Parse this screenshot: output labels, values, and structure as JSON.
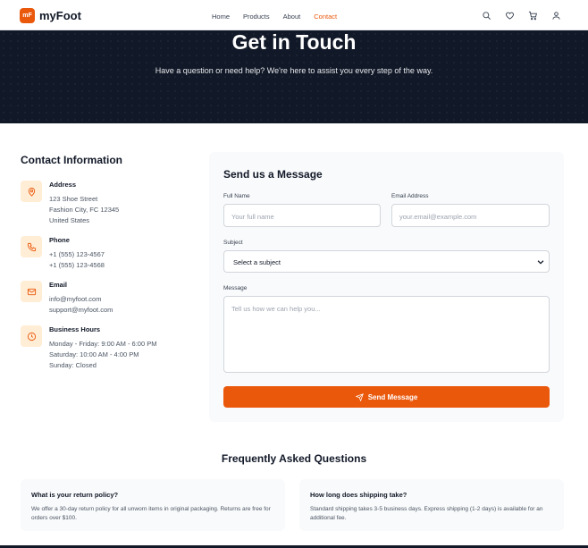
{
  "brand": {
    "mark": "mF",
    "name": "myFoot",
    "accent": "#ea580c"
  },
  "nav": {
    "links": [
      {
        "label": "Home",
        "active": false
      },
      {
        "label": "Products",
        "active": false
      },
      {
        "label": "About",
        "active": false
      },
      {
        "label": "Contact",
        "active": true
      }
    ],
    "icons": [
      "search-icon",
      "heart-icon",
      "cart-icon",
      "user-icon"
    ]
  },
  "hero": {
    "title": "Get in Touch",
    "subtitle": "Have a question or need help? We're here to assist you every step of the way."
  },
  "contact_info": {
    "title": "Contact Information",
    "items": [
      {
        "icon": "map-pin-icon",
        "label": "Address",
        "lines": [
          "123 Shoe Street",
          "Fashion City, FC 12345",
          "United States"
        ]
      },
      {
        "icon": "phone-icon",
        "label": "Phone",
        "lines": [
          "+1 (555) 123-4567",
          "+1 (555) 123-4568"
        ]
      },
      {
        "icon": "mail-icon",
        "label": "Email",
        "lines": [
          "info@myfoot.com",
          "support@myfoot.com"
        ]
      },
      {
        "icon": "clock-icon",
        "label": "Business Hours",
        "lines": [
          "Monday - Friday: 9:00 AM - 6:00 PM",
          "Saturday: 10:00 AM - 4:00 PM",
          "Sunday: Closed"
        ]
      }
    ]
  },
  "form": {
    "title": "Send us a Message",
    "full_name": {
      "label": "Full Name",
      "placeholder": "Your full name",
      "value": ""
    },
    "email": {
      "label": "Email Address",
      "placeholder": "your.email@example.com",
      "value": ""
    },
    "subject": {
      "label": "Subject",
      "selected": "Select a subject"
    },
    "message": {
      "label": "Message",
      "placeholder": "Tell us how we can help you...",
      "value": ""
    },
    "submit_label": "Send Message"
  },
  "faq": {
    "title": "Frequently Asked Questions",
    "items": [
      {
        "question": "What is your return policy?",
        "answer": "We offer a 30-day return policy for all unworn items in original packaging. Returns are free for orders over $100."
      },
      {
        "question": "How long does shipping take?",
        "answer": "Standard shipping takes 3-5 business days. Express shipping (1-2 days) is available for an additional fee."
      }
    ]
  }
}
